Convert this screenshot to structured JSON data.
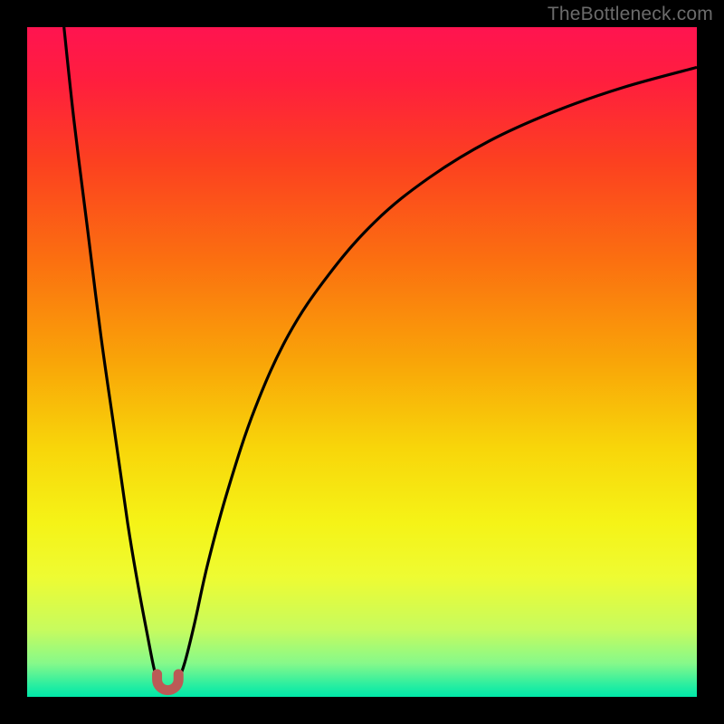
{
  "watermark": {
    "text": "TheBottleneck.com"
  },
  "gradient": {
    "stops": [
      {
        "offset": 0.0,
        "color": "#ff1450"
      },
      {
        "offset": 0.08,
        "color": "#ff1e3e"
      },
      {
        "offset": 0.2,
        "color": "#fc4020"
      },
      {
        "offset": 0.35,
        "color": "#fb7010"
      },
      {
        "offset": 0.5,
        "color": "#f9a508"
      },
      {
        "offset": 0.63,
        "color": "#f8d60a"
      },
      {
        "offset": 0.74,
        "color": "#f5f317"
      },
      {
        "offset": 0.82,
        "color": "#eefb32"
      },
      {
        "offset": 0.9,
        "color": "#c7fb5e"
      },
      {
        "offset": 0.95,
        "color": "#86f98a"
      },
      {
        "offset": 0.985,
        "color": "#22eda2"
      },
      {
        "offset": 1.0,
        "color": "#00e8a8"
      }
    ]
  },
  "curve_style": {
    "stroke": "#000000",
    "stroke_width": 3.2,
    "marker_fill": "#bb5a56",
    "marker_stroke": "#7a2f2c",
    "marker_stroke_width": 5
  },
  "chart_data": {
    "type": "line",
    "title": "",
    "xlabel": "",
    "ylabel": "",
    "xlim": [
      0,
      100
    ],
    "ylim": [
      0,
      100
    ],
    "grid": false,
    "series": [
      {
        "name": "left-branch",
        "x": [
          5.5,
          7,
          9,
          11,
          13,
          15,
          16.5,
          18,
          19,
          19.8
        ],
        "y": [
          100,
          86,
          70,
          54,
          40,
          26,
          17,
          9,
          4,
          1.5
        ]
      },
      {
        "name": "right-branch",
        "x": [
          22.2,
          23.5,
          25,
          27,
          30,
          34,
          39,
          45,
          52,
          60,
          69,
          79,
          89,
          100
        ],
        "y": [
          1.5,
          5,
          11,
          20,
          31,
          43,
          54,
          63,
          71,
          77.5,
          83,
          87.5,
          91,
          94
        ]
      }
    ],
    "marker": {
      "name": "bottom-u-marker",
      "x_range": [
        19.4,
        22.6
      ],
      "y": 1.0,
      "depth": 2.4
    }
  }
}
